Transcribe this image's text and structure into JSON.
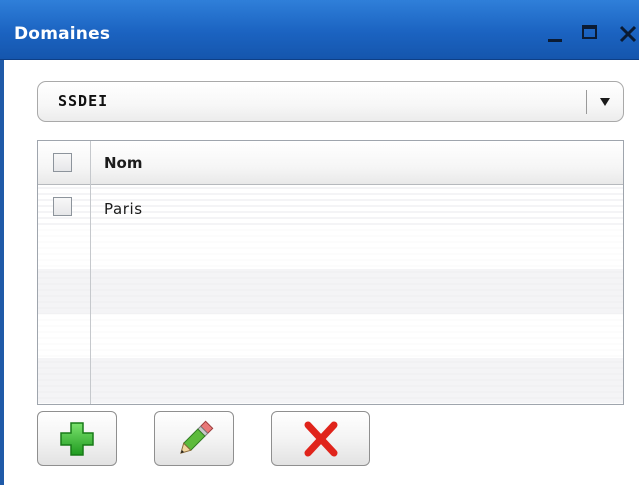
{
  "window": {
    "title": "Domaines",
    "controls": [
      "minimize-icon",
      "maximize-icon",
      "close-icon"
    ]
  },
  "domain_select": {
    "selected": "SSDEI"
  },
  "grid": {
    "columns": [
      "Nom"
    ],
    "rows": [
      {
        "nom": "Paris",
        "checked": false
      }
    ]
  },
  "toolbar": {
    "buttons": [
      {
        "icon": "plus-icon",
        "color": "#22b322"
      },
      {
        "icon": "pencil-icon",
        "color": "#4a9b2e"
      },
      {
        "icon": "delete-x-icon",
        "color": "#e0241b"
      }
    ]
  },
  "colors": {
    "titlebar": "#1b63c1",
    "title_text": "#ffffff"
  }
}
